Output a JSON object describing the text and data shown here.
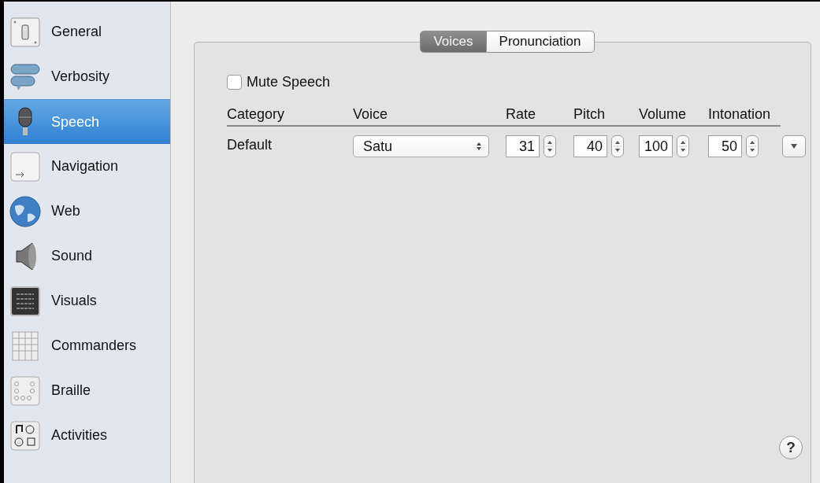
{
  "sidebar": {
    "items": [
      {
        "label": "General",
        "selected": false
      },
      {
        "label": "Verbosity",
        "selected": false
      },
      {
        "label": "Speech",
        "selected": true
      },
      {
        "label": "Navigation",
        "selected": false
      },
      {
        "label": "Web",
        "selected": false
      },
      {
        "label": "Sound",
        "selected": false
      },
      {
        "label": "Visuals",
        "selected": false
      },
      {
        "label": "Commanders",
        "selected": false
      },
      {
        "label": "Braille",
        "selected": false
      },
      {
        "label": "Activities",
        "selected": false
      }
    ]
  },
  "tabs": [
    {
      "label": "Voices",
      "selected": true
    },
    {
      "label": "Pronunciation",
      "selected": false
    }
  ],
  "mute_speech": {
    "label": "Mute Speech",
    "checked": false
  },
  "table": {
    "columns": [
      "Category",
      "Voice",
      "Rate",
      "Pitch",
      "Volume",
      "Intonation"
    ],
    "rows": [
      {
        "category": "Default",
        "voice": "Satu",
        "rate": "31",
        "pitch": "40",
        "volume": "100",
        "intonation": "50"
      }
    ]
  },
  "help_button": "?"
}
